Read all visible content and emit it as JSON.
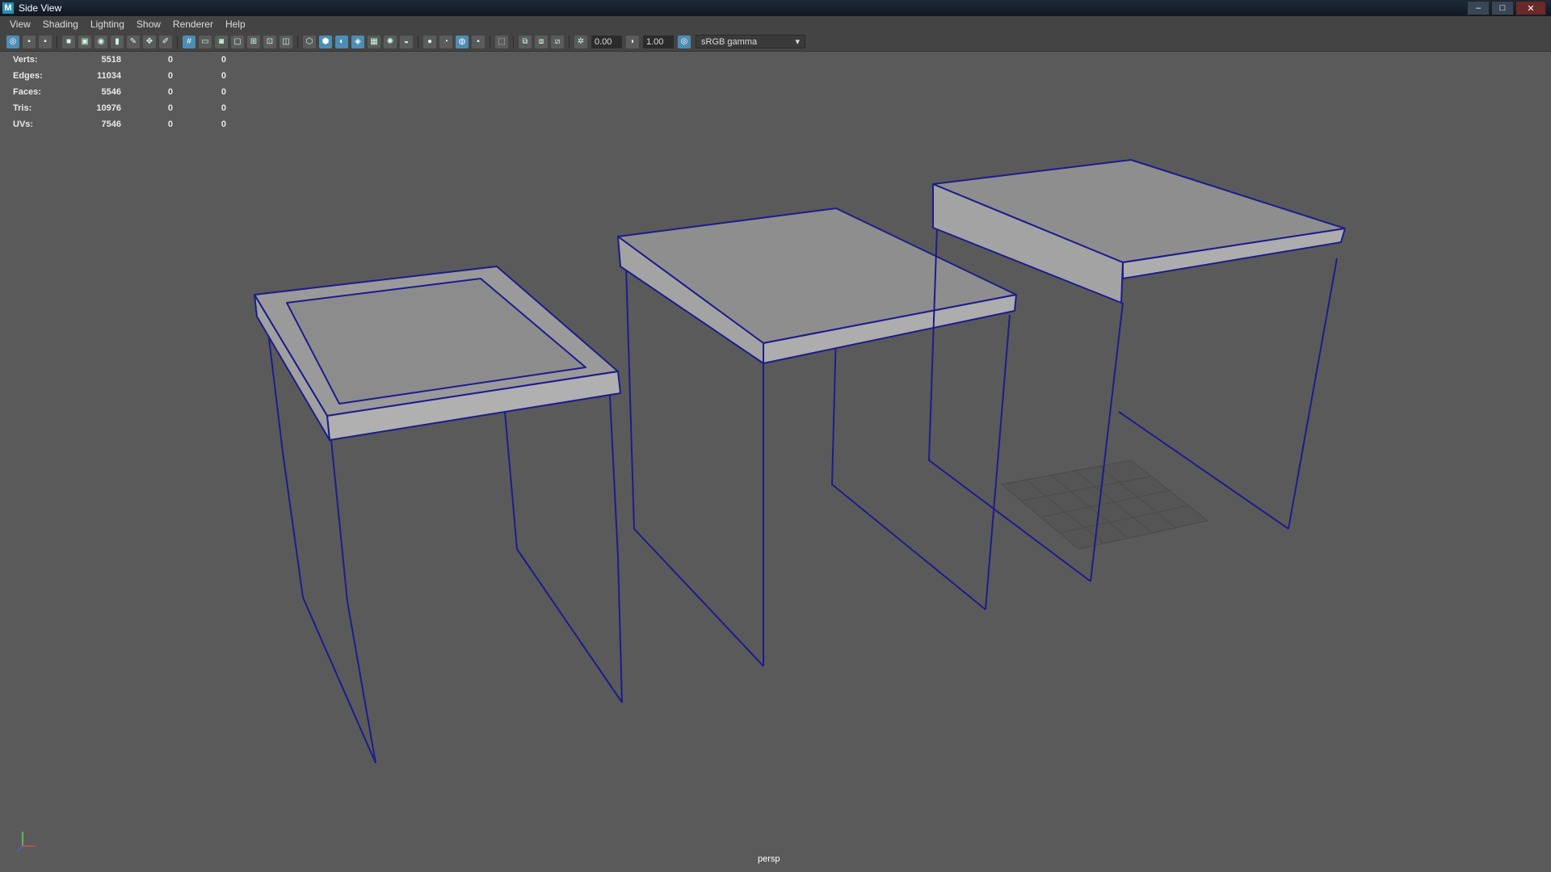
{
  "window": {
    "title": "Side View",
    "app_icon": "maya-icon"
  },
  "menu": [
    "View",
    "Shading",
    "Lighting",
    "Show",
    "Renderer",
    "Help"
  ],
  "toolbar": {
    "exposure_value": "0.00",
    "gamma_value": "1.00",
    "color_space": "sRGB gamma"
  },
  "hud": [
    {
      "label": "Verts:",
      "value": "5518",
      "a": "0",
      "b": "0"
    },
    {
      "label": "Edges:",
      "value": "11034",
      "a": "0",
      "b": "0"
    },
    {
      "label": "Faces:",
      "value": "5546",
      "a": "0",
      "b": "0"
    },
    {
      "label": "Tris:",
      "value": "10976",
      "a": "0",
      "b": "0"
    },
    {
      "label": "UVs:",
      "value": "7546",
      "a": "0",
      "b": "0"
    }
  ],
  "camera": "persp",
  "colors": {
    "viewport_bg": "#5a5a5a",
    "wireframe": "#1c1c8c",
    "surface": "#8a8a8a"
  }
}
